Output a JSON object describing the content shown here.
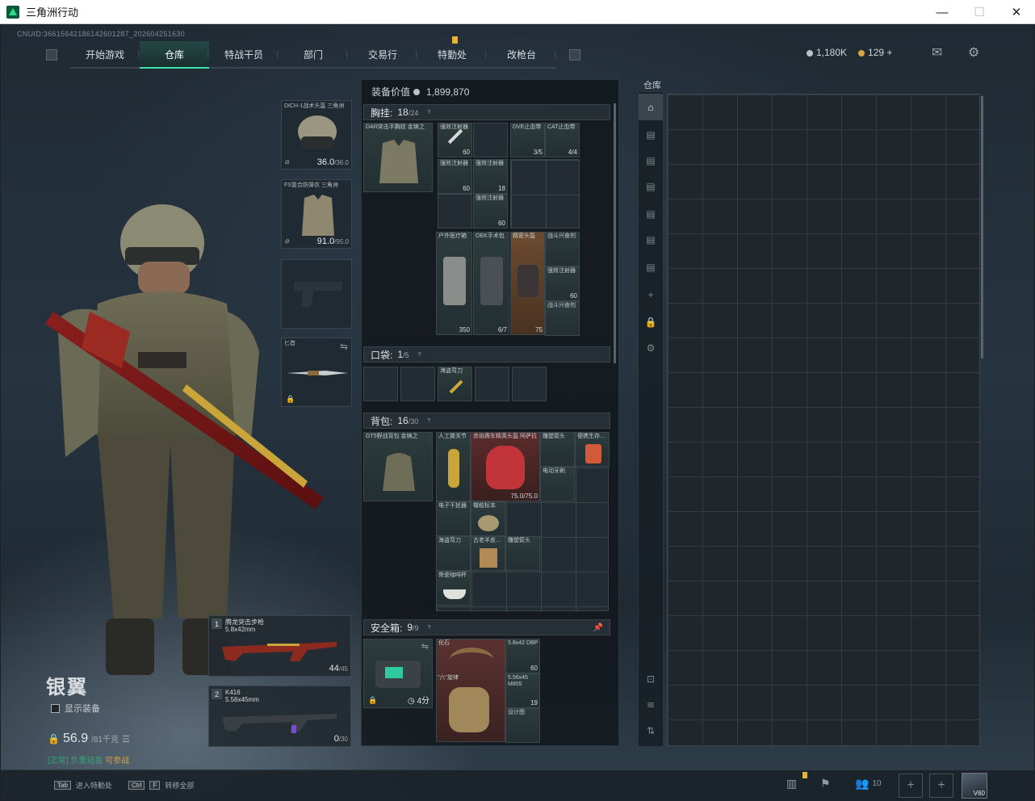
{
  "window": {
    "title": "三角洲行动",
    "minimize": "—",
    "maximize": "☐",
    "close": "✕"
  },
  "uid": "CNUID:36615642186142601287_202604251630",
  "nav": {
    "tabs": [
      {
        "label": "开始游戏",
        "active": false
      },
      {
        "label": "仓库",
        "active": true
      },
      {
        "label": "特战干员",
        "active": false
      },
      {
        "label": "部门",
        "active": false
      },
      {
        "label": "交易行",
        "active": false
      },
      {
        "label": "特勤处",
        "active": false,
        "alert": true
      },
      {
        "label": "改枪台",
        "active": false
      }
    ]
  },
  "currency": {
    "silver": "1,180K",
    "gold": "129",
    "gold_add": "+"
  },
  "character": {
    "name": "银翼",
    "show_gear_label": "显示装备",
    "weight": "56.9",
    "weight_max": "/81千克",
    "status_tag": "[正常]",
    "status_text": "负重轻盈",
    "status_note": "可参战"
  },
  "equipment": {
    "helmet": {
      "label": "DICH-1战术头盔 三角洲",
      "durability": "36.0",
      "durability_max": "/36.0"
    },
    "armor": {
      "label": "FS复合防弹衣 三角洲",
      "durability": "91.0",
      "durability_max": "/95.0"
    },
    "melee": {
      "label": "匕首"
    }
  },
  "weapons": [
    {
      "slot": "1",
      "name": "腾龙突击步枪",
      "ammo_type": "5.8x42mm",
      "ammo": "44",
      "ammo_max": "/45"
    },
    {
      "slot": "2",
      "name": "K416",
      "ammo_type": "5.56x45mm",
      "ammo": "0",
      "ammo_max": "/30"
    }
  ],
  "loadout": {
    "value_label": "装备价值",
    "value": "1,899,870",
    "chest_rig": {
      "label": "胸挂:",
      "count": "18",
      "capacity": "/24",
      "item": "DAR突击手胸挂 金铸之"
    },
    "chest_items": [
      {
        "label": "强效注射器",
        "n": "60"
      },
      {
        "label": "DVE止血带",
        "n": "3/5"
      },
      {
        "label": "CAT止血带",
        "n": "4/4"
      },
      {
        "label": "强效注射器",
        "n": "60"
      },
      {
        "label": "强效注射器",
        "n": "18"
      },
      {
        "label": "强效注射器",
        "n": "60"
      },
      {
        "label": "户外医疗箱",
        "n": "350"
      },
      {
        "label": "OEK手术包",
        "n": "6/7"
      },
      {
        "label": "精密头盔",
        "n": "75"
      },
      {
        "label": "战斗兴奋剂",
        "n": ""
      },
      {
        "label": "强效注射器",
        "n": "60"
      },
      {
        "label": "战斗兴奋剂",
        "n": ""
      }
    ],
    "pockets": {
      "label": "口袋:",
      "count": "1",
      "capacity": "/5",
      "item": "海盗弯刀"
    },
    "backpack": {
      "label": "背包:",
      "count": "16",
      "capacity": "/30",
      "item": "GT5野战背包 金铸之"
    },
    "backpack_items": [
      {
        "label": "人工膝关节",
        "n": ""
      },
      {
        "label": "赤焰赛车精英头盔 阿萨拉",
        "n": "75.0/75.0"
      },
      {
        "label": "雕塑箭头",
        "n": ""
      },
      {
        "label": "便携生存...",
        "n": ""
      },
      {
        "label": "电动牙刷",
        "n": ""
      },
      {
        "label": "电子干扰器",
        "n": ""
      },
      {
        "label": "橄榄标本",
        "n": ""
      },
      {
        "label": "海盗弯刀",
        "n": ""
      },
      {
        "label": "古老羊皮...",
        "n": ""
      },
      {
        "label": "雕塑箭头",
        "n": ""
      },
      {
        "label": "骨瓷咖啡杯",
        "n": ""
      }
    ],
    "safebox": {
      "label": "安全箱:",
      "count": "9",
      "capacity": "/9",
      "timer": "4分"
    },
    "safebox_items": [
      {
        "label": "化石",
        "n": ""
      },
      {
        "label": "5.8x42 DBP",
        "n": "60"
      },
      {
        "label": "\"六\"旋律",
        "n": ""
      },
      {
        "label": "5.56x45 M855",
        "n": "19"
      },
      {
        "label": "设计图",
        "n": ""
      }
    ]
  },
  "warehouse": {
    "title": "仓库"
  },
  "bottom": {
    "hint1_key": "Tab",
    "hint1_text": "进入特勤处",
    "hint2_key1": "Ctrl",
    "hint2_key2": "F",
    "hint2_text": "转移全部",
    "squad_count": "10",
    "avatar_label": "V60"
  }
}
